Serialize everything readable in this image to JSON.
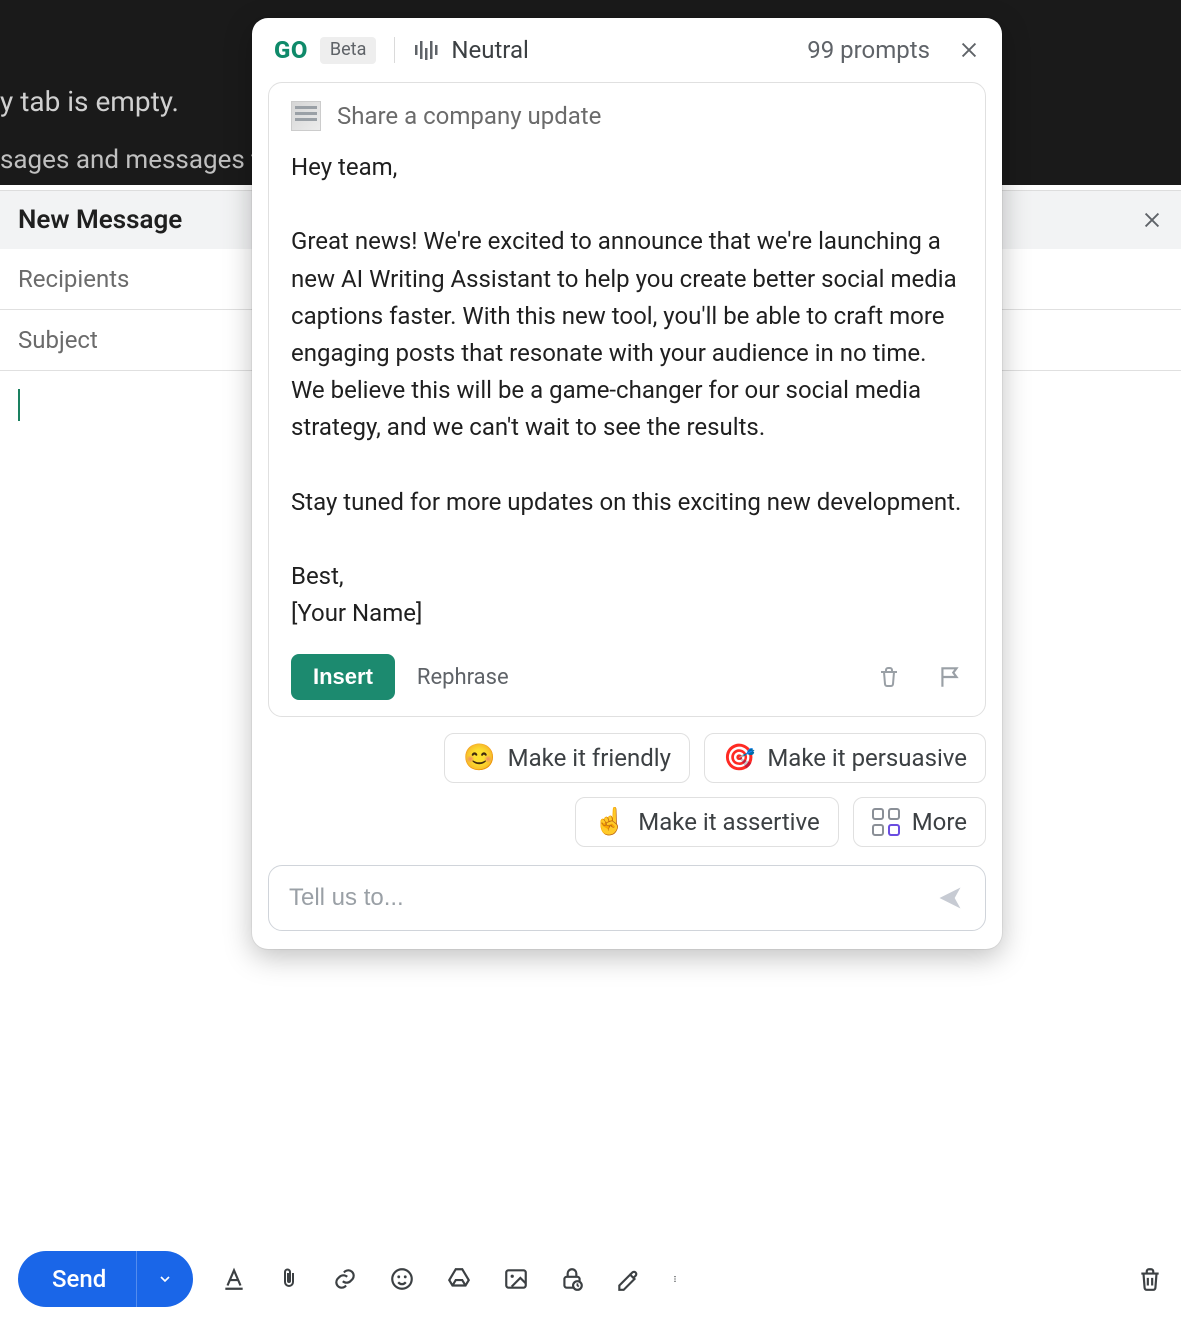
{
  "background": {
    "line1": "y tab is empty.",
    "line2": "sages and messages t"
  },
  "compose": {
    "title": "New Message",
    "recipients_placeholder": "Recipients",
    "subject_placeholder": "Subject"
  },
  "ai": {
    "logo": "GO",
    "badge": "Beta",
    "tone": "Neutral",
    "prompts_count": "99 prompts",
    "suggestion_title": "Share a company update",
    "generated_text": "Hey team,\n\nGreat news! We're excited to announce that we're launching a new AI Writing Assistant to help you create better social media captions faster. With this new tool, you'll be able to craft more engaging posts that resonate with your audience in no time. We believe this will be a game-changer for our social media strategy, and we can't wait to see the results.\n\nStay tuned for more updates on this exciting new development.\n\nBest,\n[Your Name]",
    "insert_label": "Insert",
    "rephrase_label": "Rephrase",
    "chips": {
      "friendly": "Make it friendly",
      "persuasive": "Make it persuasive",
      "assertive": "Make it assertive",
      "more": "More"
    },
    "prompt_placeholder": "Tell us to..."
  },
  "toolbar": {
    "send_label": "Send"
  }
}
